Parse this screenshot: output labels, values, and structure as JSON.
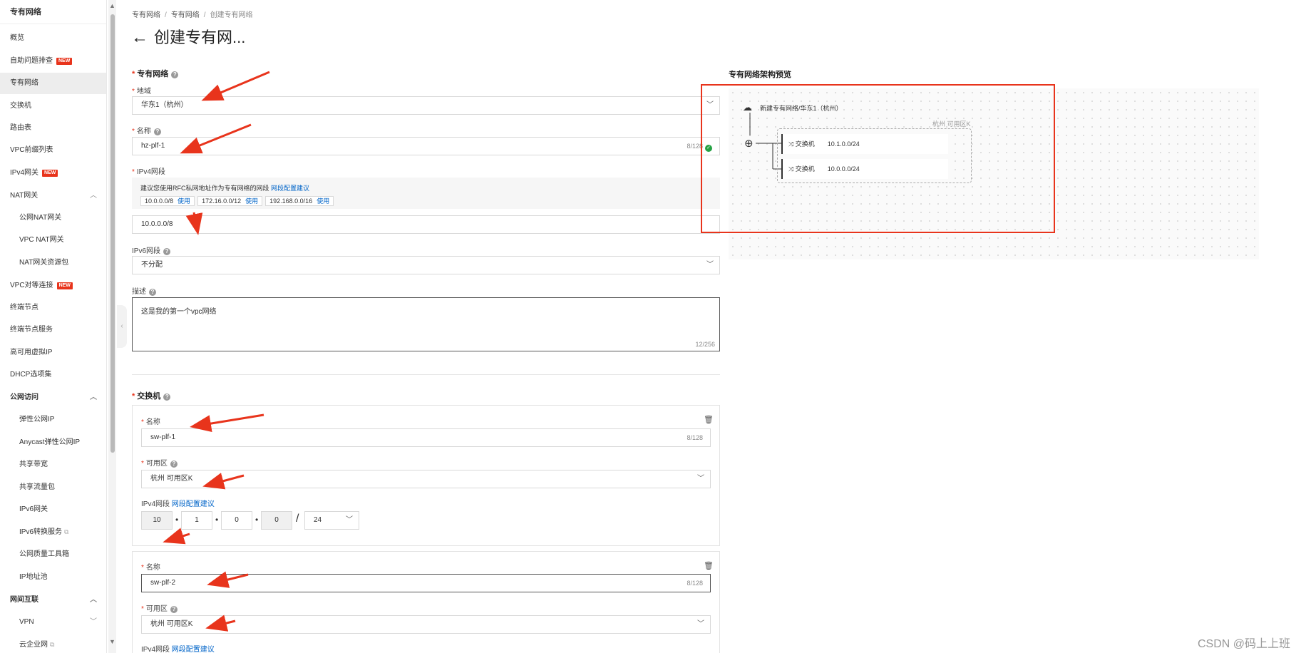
{
  "sidebar": {
    "title": "专有网络",
    "items": [
      {
        "label": "概览"
      },
      {
        "label": "自助问题排查",
        "badge": "NEW"
      },
      {
        "label": "专有网络"
      },
      {
        "label": "交换机"
      },
      {
        "label": "路由表"
      },
      {
        "label": "VPC前缀列表"
      },
      {
        "label": "IPv4网关",
        "badge": "NEW"
      },
      {
        "label": "NAT网关"
      },
      {
        "label": "公网NAT网关"
      },
      {
        "label": "VPC NAT网关"
      },
      {
        "label": "NAT网关资源包"
      },
      {
        "label": "VPC对等连接",
        "badge": "NEW"
      },
      {
        "label": "终端节点"
      },
      {
        "label": "终端节点服务"
      },
      {
        "label": "高可用虚拟IP"
      },
      {
        "label": "DHCP选项集"
      },
      {
        "label": "公网访问"
      },
      {
        "label": "弹性公网IP"
      },
      {
        "label": "Anycast弹性公网IP"
      },
      {
        "label": "共享带宽"
      },
      {
        "label": "共享流量包"
      },
      {
        "label": "IPv6网关"
      },
      {
        "label": "IPv6转换服务"
      },
      {
        "label": "公网质量工具箱"
      },
      {
        "label": "IP地址池"
      },
      {
        "label": "网间互联"
      },
      {
        "label": "VPN"
      },
      {
        "label": "云企业网"
      }
    ]
  },
  "breadcrumb": [
    "专有网络",
    "专有网络",
    "创建专有网络"
  ],
  "page_title": "创建专有网...",
  "vpc": {
    "section_title": "专有网络",
    "region_label": "地域",
    "region_value": "华东1（杭州）",
    "name_label": "名称",
    "name_value": "hz-plf-1",
    "name_count": "8/128",
    "ipv4_label": "IPv4网段",
    "hint_text": "建议您使用RFC私网地址作为专有网络的网段",
    "hint_link": "网段配置建议",
    "suggestions": [
      {
        "cidr": "10.0.0.0/8",
        "action": "使用"
      },
      {
        "cidr": "172.16.0.0/12",
        "action": "使用"
      },
      {
        "cidr": "192.168.0.0/16",
        "action": "使用"
      }
    ],
    "ipv4_value": "10.0.0.0/8",
    "ipv6_label": "IPv6网段",
    "ipv6_value": "不分配",
    "desc_label": "描述",
    "desc_value": "这是我的第一个vpc网络",
    "desc_count": "12/256"
  },
  "switch_section": {
    "title": "交换机",
    "switches": [
      {
        "name_label": "名称",
        "name_value": "sw-plf-1",
        "name_count": "8/128",
        "zone_label": "可用区",
        "zone_value": "杭州 可用区K",
        "ipv4_label": "IPv4网段",
        "ipv4_link": "网段配置建议",
        "octets": [
          "10",
          "1",
          "0",
          "0"
        ],
        "mask": "24"
      },
      {
        "name_label": "名称",
        "name_value": "sw-plf-2",
        "name_count": "8/128",
        "zone_label": "可用区",
        "zone_value": "杭州 可用区K",
        "ipv4_label": "IPv4网段",
        "ipv4_link": "网段配置建议"
      }
    ]
  },
  "preview": {
    "title": "专有网络架构预览",
    "vpc_label": "新建专有网络/华东1（杭州）",
    "zone_label": "杭州 可用区K",
    "switches": [
      {
        "label": "交换机",
        "cidr": "10.1.0.0/24"
      },
      {
        "label": "交换机",
        "cidr": "10.0.0.0/24"
      }
    ]
  },
  "watermark": "CSDN @码上上班",
  "colors": {
    "accent_red": "#e8341c",
    "link_blue": "#0064c8",
    "success_green": "#25a244"
  }
}
